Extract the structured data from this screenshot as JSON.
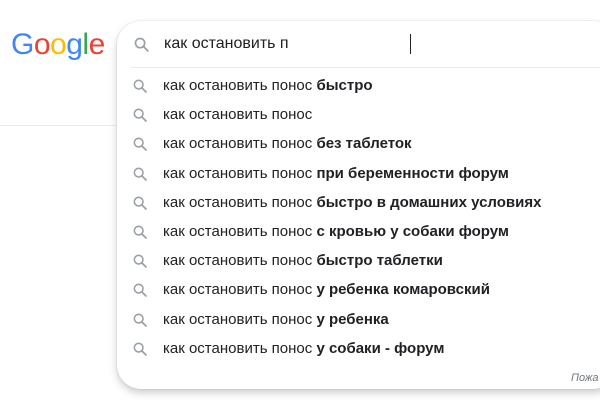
{
  "logo": {
    "letters": [
      {
        "char": "G",
        "color": "#4285F4"
      },
      {
        "char": "o",
        "color": "#EA4335"
      },
      {
        "char": "o",
        "color": "#FBBC05"
      },
      {
        "char": "g",
        "color": "#4285F4"
      },
      {
        "char": "l",
        "color": "#34A853"
      },
      {
        "char": "e",
        "color": "#EA4335"
      }
    ]
  },
  "search": {
    "value": "как остановить п",
    "icon": "search-icon"
  },
  "suggestions": [
    {
      "prefix": "как остановить понос ",
      "completion": "быстро"
    },
    {
      "prefix": "как остановить понос",
      "completion": ""
    },
    {
      "prefix": "как остановить понос ",
      "completion": "без таблеток"
    },
    {
      "prefix": "как остановить понос ",
      "completion": "при беременности форум"
    },
    {
      "prefix": "как остановить понос ",
      "completion": "быстро в домашних условиях"
    },
    {
      "prefix": "как остановить понос ",
      "completion": "с кровью у собаки форум"
    },
    {
      "prefix": "как остановить понос ",
      "completion": "быстро таблетки"
    },
    {
      "prefix": "как остановить понос ",
      "completion": "у ребенка комаровский"
    },
    {
      "prefix": "как остановить понос ",
      "completion": "у ребенка"
    },
    {
      "prefix": "как остановить понос ",
      "completion": "у собаки - форум"
    }
  ],
  "footer": {
    "report_label": "Пожа"
  },
  "colors": {
    "text": "#202124",
    "icon": "#9aa0a6",
    "muted": "#70757a"
  }
}
